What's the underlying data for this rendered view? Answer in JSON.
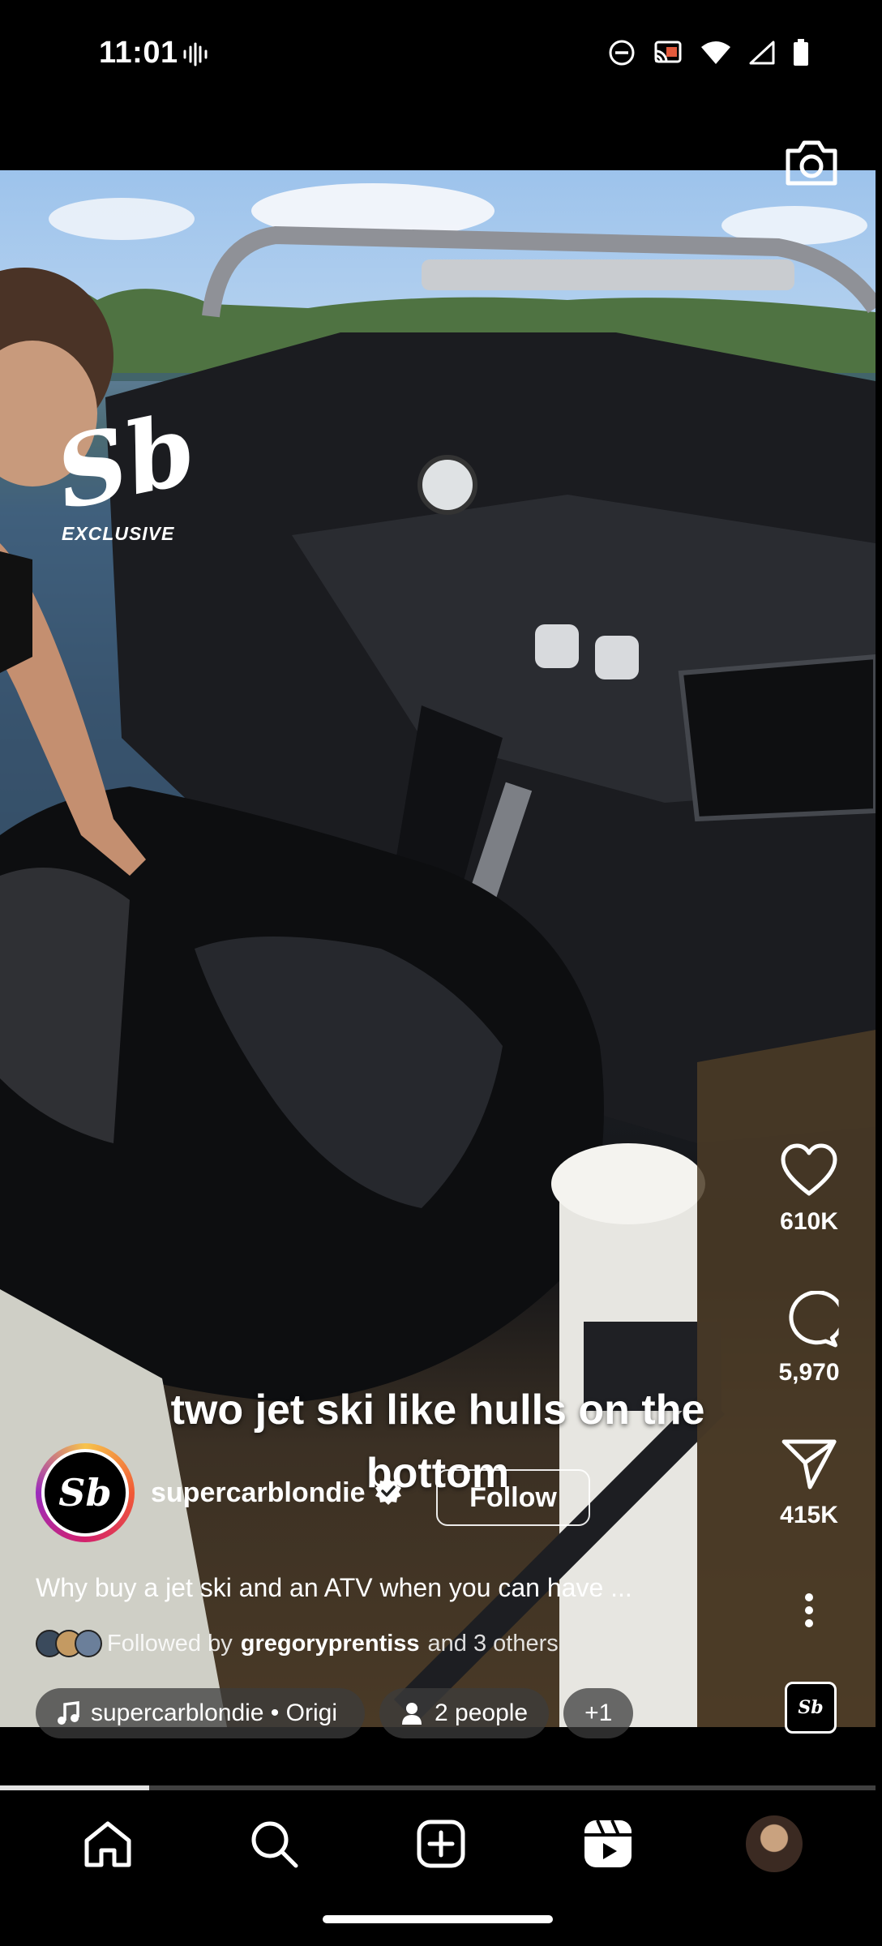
{
  "status_bar": {
    "time": "11:01"
  },
  "video": {
    "watermark_logo": "Sb",
    "watermark_label": "EXCLUSIVE",
    "caption": "two jet ski like hulls on the bottom"
  },
  "actions": {
    "likes": "610K",
    "comments": "5,970",
    "shares": "415K"
  },
  "account": {
    "avatar_text": "Sb",
    "username": "supercarblondie",
    "follow_label": "Follow"
  },
  "description": "Why buy a jet ski and an ATV when you can have ...",
  "followed_by": {
    "prefix": "Followed by",
    "name": "gregoryprentiss",
    "suffix": "and 3 others"
  },
  "chips": {
    "audio": "supercarblondie • Origi",
    "people": "2 people",
    "more": "+1"
  },
  "reel_thumb_text": "Sb",
  "playback_progress": 0.17,
  "icons": {
    "status": [
      "vibrate-icon",
      "do-not-disturb-icon",
      "cast-icon",
      "wifi-icon",
      "signal-icon",
      "battery-icon"
    ],
    "rail": [
      "camera-icon",
      "heart-icon",
      "comment-icon",
      "share-icon",
      "more-icon"
    ],
    "nav": [
      "home-icon",
      "search-icon",
      "create-icon",
      "reels-icon",
      "profile-avatar"
    ]
  }
}
